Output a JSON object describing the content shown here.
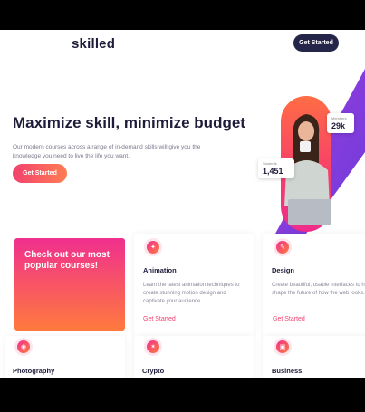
{
  "header": {
    "logo": "skilled",
    "cta": "Get Started"
  },
  "hero": {
    "title": "Maximize skill, minimize budget",
    "subtitle": "Our modern courses across a range of in-demand skills will give you the knowledge you need to live the life you want.",
    "cta": "Get Started",
    "stats": [
      {
        "label": "Students",
        "value": "1,451"
      },
      {
        "label": "Members",
        "value": "29k"
      }
    ]
  },
  "courses": {
    "promo": "Check out our most popular courses!",
    "items": [
      {
        "title": "Animation",
        "icon": "animation-icon",
        "description": "Learn the latest animation techniques to create stunning motion design and captivate your audience.",
        "link": "Get Started"
      },
      {
        "title": "Design",
        "icon": "design-icon",
        "description": "Create beautiful, usable interfaces to help shape the future of how the web looks.",
        "link": "Get Started"
      },
      {
        "title": "Photography",
        "icon": "camera-icon"
      },
      {
        "title": "Crypto",
        "icon": "crypto-icon"
      },
      {
        "title": "Business",
        "icon": "briefcase-icon"
      }
    ]
  },
  "colors": {
    "accent": "#f2426e",
    "accent2": "#ff7d52",
    "navy": "#25254a",
    "purple": "#7b3fe4"
  }
}
